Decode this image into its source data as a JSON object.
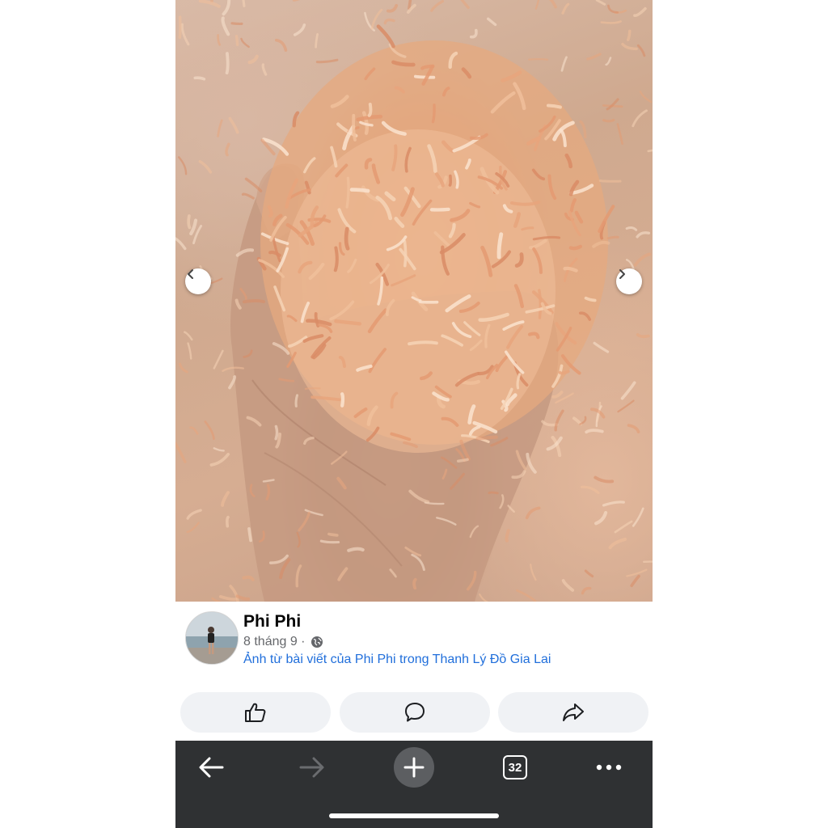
{
  "photo": {
    "subject": "dried-shrimp-in-hand",
    "prev_icon": "chevron-left-icon",
    "next_icon": "chevron-right-icon"
  },
  "post": {
    "author": "Phi Phi",
    "date": "8 tháng 9 ·",
    "privacy_icon": "globe-icon",
    "source_text": "Ảnh từ bài viết của Phi Phi trong Thanh Lý Đồ Gia Lai"
  },
  "actions": [
    {
      "name": "like",
      "icon": "thumbs-up-icon"
    },
    {
      "name": "comment",
      "icon": "comment-icon"
    },
    {
      "name": "share",
      "icon": "share-icon"
    }
  ],
  "browser_toolbar": {
    "back_icon": "arrow-left-icon",
    "forward_icon": "arrow-right-icon",
    "new_tab_icon": "plus-icon",
    "tab_count": "32",
    "more_icon": "more-dots-icon"
  },
  "colors": {
    "link": "#216fdb",
    "toolbar_bg": "#2f3133",
    "action_bg": "#f0f2f5"
  }
}
